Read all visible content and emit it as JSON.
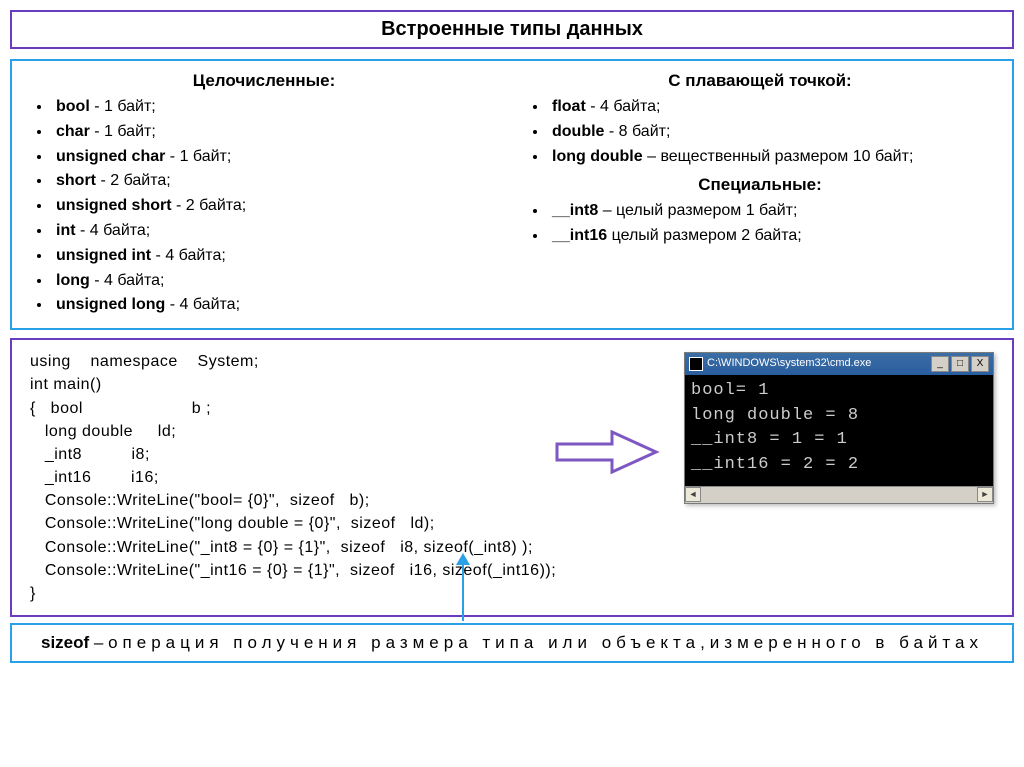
{
  "title": "Встроенные типы данных",
  "integerHeader": "Целочисленные:",
  "floatHeader": "С плавающей точкой:",
  "specialHeader": "Специальные:",
  "int_items": [
    {
      "t": "bool",
      "d": "- 1 байт;"
    },
    {
      "t": "char",
      "d": "- 1 байт;"
    },
    {
      "t": "unsigned  char",
      "d": "- 1 байт;"
    },
    {
      "t": "short",
      "d": "- 2 байта;"
    },
    {
      "t": "unsigned  short",
      "d": "- 2 байта;"
    },
    {
      "t": "int",
      "d": "- 4 байта;"
    },
    {
      "t": "unsigned  int",
      "d": "- 4 байта;"
    },
    {
      "t": "long",
      "d": "- 4 байта;"
    },
    {
      "t": "unsigned  long",
      "d": "- 4 байта;"
    }
  ],
  "float_items": [
    {
      "t": "float",
      "d": "- 4 байта;"
    },
    {
      "t": "double",
      "d": "- 8 байт;"
    },
    {
      "t": "long double",
      "d": "– вещественный размером 10 байт;"
    }
  ],
  "special_items": [
    {
      "t": "__int8",
      "d": "– целый размером 1 байт;"
    },
    {
      "t": "__int16",
      "d": "целый размером 2 байта;"
    }
  ],
  "code_lines": [
    "using    namespace    System;",
    "int main()",
    "{   bool                      b ;",
    "   long double     ld;",
    "   _int8          i8;",
    "   _int16        i16;",
    "   Console::WriteLine(\"bool= {0}\",  sizeof   b);",
    "   Console::WriteLine(\"long double = {0}\",  sizeof   ld);",
    "   Console::WriteLine(\"_int8 = {0} = {1}\",  sizeof   i8, sizeof(_int8) );",
    "   Console::WriteLine(\"_int16 = {0} = {1}\",  sizeof   i16, sizeof(_int16));",
    "}"
  ],
  "console": {
    "path": "C:\\WINDOWS\\system32\\cmd.exe",
    "min": "_",
    "max": "□",
    "close": "X",
    "arrL": "◄",
    "arrR": "►",
    "out": "bool= 1\nlong double = 8\n__int8 = 1 = 1\n__int16 = 2 = 2"
  },
  "footer": {
    "kw": "sizeof",
    "dash": " – ",
    "text": "операция получения размера типа или объекта,измеренного в байтах"
  }
}
